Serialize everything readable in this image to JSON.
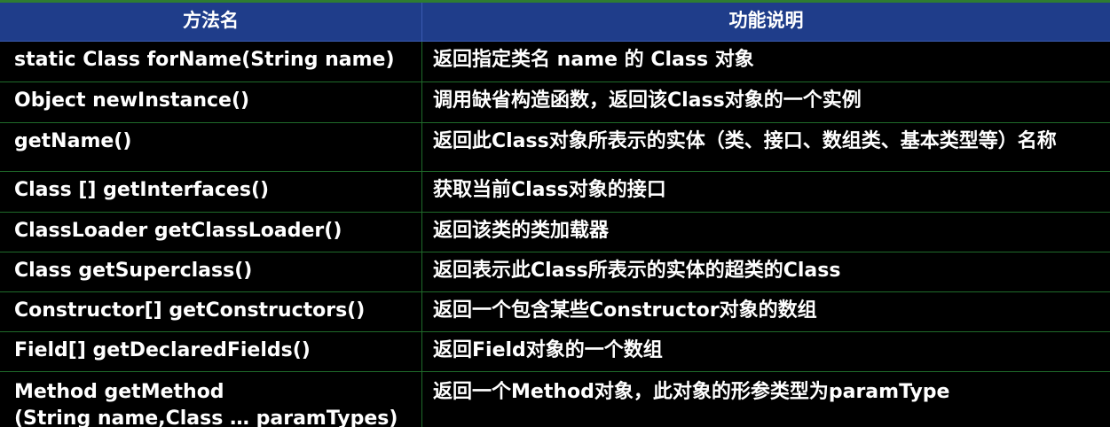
{
  "header": {
    "method_col": "方法名",
    "desc_col": "功能说明"
  },
  "rows": [
    {
      "method": "static Class  forName(String name)",
      "desc": "返回指定类名 name 的 Class 对象"
    },
    {
      "method": "Object newInstance()",
      "desc": "调用缺省构造函数，返回该Class对象的一个实例"
    },
    {
      "method": "getName()",
      "desc": "返回此Class对象所表示的实体（类、接口、数组类、基本类型等）名称"
    },
    {
      "method": "Class [] getInterfaces()",
      "desc": "获取当前Class对象的接口"
    },
    {
      "method": "ClassLoader getClassLoader()",
      "desc": "返回该类的类加载器"
    },
    {
      "method": "Class getSuperclass()",
      "desc": "返回表示此Class所表示的实体的超类的Class"
    },
    {
      "method": "Constructor[] getConstructors()",
      "desc": "返回一个包含某些Constructor对象的数组"
    },
    {
      "method": "Field[] getDeclaredFields()",
      "desc": "返回Field对象的一个数组"
    },
    {
      "method": "Method getMethod",
      "method_line2": "(String name,Class  …  paramTypes)",
      "desc": "返回一个Method对象，此对象的形参类型为paramType"
    }
  ],
  "colors": {
    "header_bg": "#1f3d8a",
    "body_bg": "#000000",
    "grid": "#1f6b2a",
    "text": "#ffffff"
  }
}
